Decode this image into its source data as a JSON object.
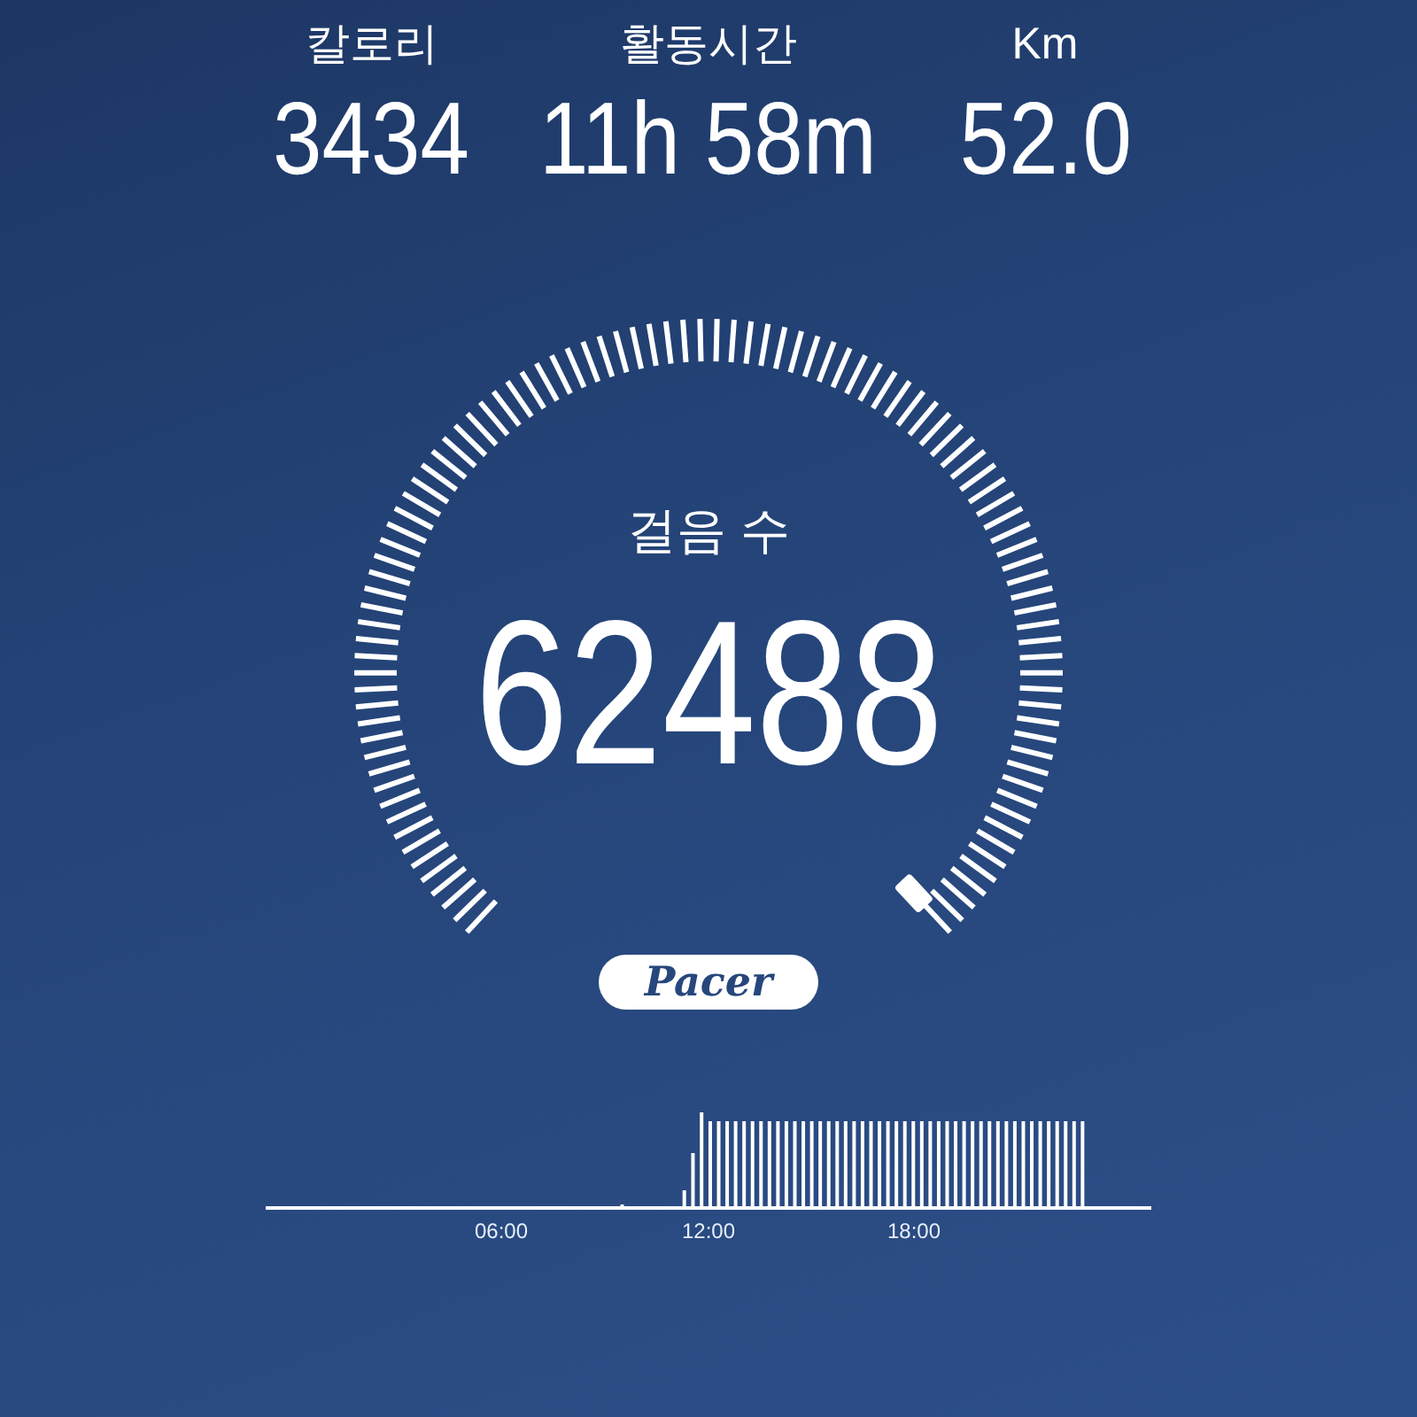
{
  "stats": [
    {
      "label": "칼로리",
      "value": "3434"
    },
    {
      "label": "활동시간",
      "value": "11h 58m"
    },
    {
      "label": "Km",
      "value": "52.0"
    }
  ],
  "gauge": {
    "label": "걸음 수",
    "value": "62488"
  },
  "logo": {
    "text": "Pacer"
  },
  "activity": {
    "time_labels": [
      "06:00",
      "12:00",
      "18:00"
    ]
  }
}
